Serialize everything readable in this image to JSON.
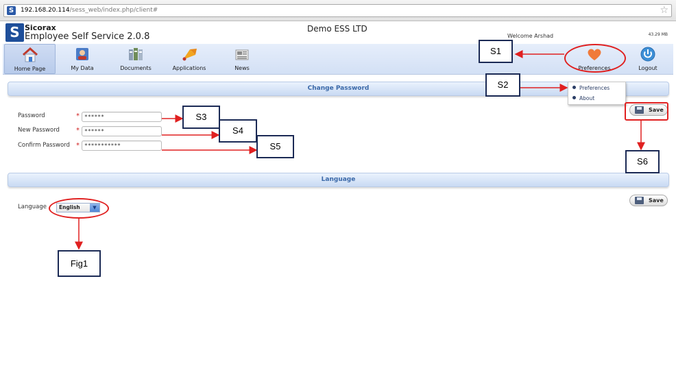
{
  "browser": {
    "url_host": "192.168.20.114",
    "url_path": "/sess_web/index.php/client#",
    "site_icon_letter": "S",
    "star_icon": "star-icon"
  },
  "header": {
    "logo_letter": "S",
    "brand": "Sicorax",
    "app_title": "Employee Self Service 2.0.8",
    "company": "Demo ESS LTD",
    "welcome": "Welcome Arshad",
    "memory": "43.29 MB"
  },
  "nav": {
    "items": [
      {
        "label": "Home Page",
        "icon": "home-icon"
      },
      {
        "label": "My Data",
        "icon": "user-data-icon"
      },
      {
        "label": "Documents",
        "icon": "documents-icon"
      },
      {
        "label": "Applications",
        "icon": "applications-icon"
      },
      {
        "label": "News",
        "icon": "news-icon"
      },
      {
        "label": "Preferences",
        "icon": "heart-icon"
      },
      {
        "label": "Logout",
        "icon": "power-icon"
      }
    ]
  },
  "preferences_menu": {
    "items": [
      "Preferences",
      "About"
    ]
  },
  "change_password": {
    "title": "Change Password",
    "password_label": "Password",
    "password_value": "******",
    "new_password_label": "New Password",
    "new_password_value": "******",
    "confirm_password_label": "Confirm Password",
    "confirm_password_value": "***********",
    "required_mark": "*",
    "save_label": "Save"
  },
  "language": {
    "title": "Language",
    "label": "Language",
    "selected": "English",
    "save_label": "Save"
  },
  "annotations": {
    "s1": "S1",
    "s2": "S2",
    "s3": "S3",
    "s4": "S4",
    "s5": "S5",
    "s6": "S6",
    "fig1": "Fig1"
  },
  "colors": {
    "annotation_red": "#e02020",
    "annotation_box_border": "#1b2a55",
    "nav_bg": "#d3e0f5",
    "section_title": "#3a68a8"
  }
}
